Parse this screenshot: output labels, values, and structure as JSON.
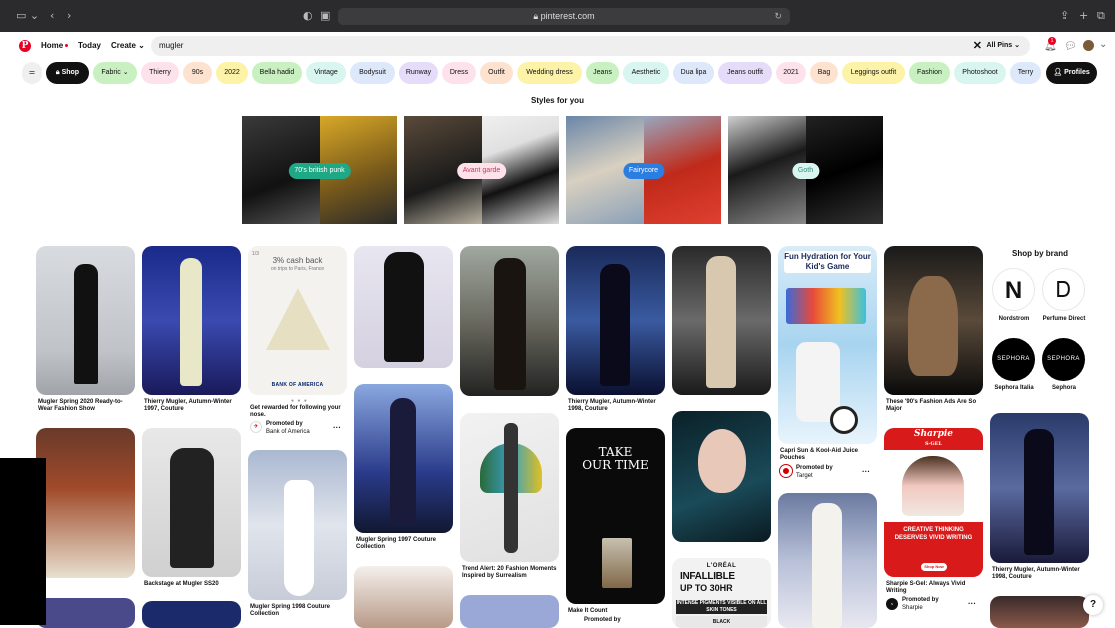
{
  "browser": {
    "url": "pinterest.com",
    "sidebar_icon": "sidebar-icon",
    "lock_icon": "lock-icon"
  },
  "header": {
    "logo": "P",
    "home_label": "Home",
    "today_label": "Today",
    "create_label": "Create",
    "search_value": "mugler",
    "search_scope": "All Pins",
    "notification_count": "1"
  },
  "chips": [
    {
      "label": "Shop",
      "bg": "#111111"
    },
    {
      "label": "Fabric",
      "bg": "#c8f0c0"
    },
    {
      "label": "Thierry",
      "bg": "#fde2ec"
    },
    {
      "label": "90s",
      "bg": "#fde3cf"
    },
    {
      "label": "2022",
      "bg": "#fdf3a8"
    },
    {
      "label": "Bella hadid",
      "bg": "#c8f0c0"
    },
    {
      "label": "Vintage",
      "bg": "#d8f5f0"
    },
    {
      "label": "Bodysuit",
      "bg": "#dde8fb"
    },
    {
      "label": "Runway",
      "bg": "#e4dcf9"
    },
    {
      "label": "Dress",
      "bg": "#fde2ec"
    },
    {
      "label": "Outfit",
      "bg": "#fde3cf"
    },
    {
      "label": "Wedding dress",
      "bg": "#fdf3a8"
    },
    {
      "label": "Jeans",
      "bg": "#c8f0c0"
    },
    {
      "label": "Aesthetic",
      "bg": "#d8f5f0"
    },
    {
      "label": "Dua lipa",
      "bg": "#dde8fb"
    },
    {
      "label": "Jeans outfit",
      "bg": "#e4dcf9"
    },
    {
      "label": "2021",
      "bg": "#fde2ec"
    },
    {
      "label": "Bag",
      "bg": "#fde3cf"
    },
    {
      "label": "Leggings outfit",
      "bg": "#fdf3a8"
    },
    {
      "label": "Fashion",
      "bg": "#c8f0c0"
    },
    {
      "label": "Photoshoot",
      "bg": "#d8f5f0"
    },
    {
      "label": "Terry",
      "bg": "#dde8fb"
    },
    {
      "label": "Profiles",
      "bg": "#111111"
    }
  ],
  "styles": {
    "title": "Styles for you",
    "items": [
      {
        "label": "70's british punk",
        "label_bg": "#1ea886",
        "label_color": "#ffffff"
      },
      {
        "label": "Avant garde",
        "label_bg": "#fde2ec",
        "label_color": "#c23c5a"
      },
      {
        "label": "Fairycore",
        "label_bg": "#2a7de1",
        "label_color": "#ffffff"
      },
      {
        "label": "Goth",
        "label_bg": "#d8f5f0",
        "label_color": "#3a8c7c"
      }
    ]
  },
  "pins": {
    "p1": "Mugler Spring 2020 Ready-to-Wear Fashion Show",
    "p2": "Thierry Mugler, Autumn-Winter 1997, Couture",
    "ad_cashback_title": "3% cash back",
    "ad_cashback_sub": "on trips to Paris, France",
    "ad_boa_brand": "BANK OF AMERICA",
    "ad_boa_caption": "Get rewarded for following your nose.",
    "ad_boa_promoted": "Promoted by",
    "ad_boa_by": "Bank of America",
    "ad_page_num": "1/3",
    "p_backstage": "Backstage at Mugler SS20",
    "p_spring1998": "Mugler Spring 1998 Couture Collection",
    "p_spring1997": "Mugler Spring 1997 Couture Collection",
    "p_trend": "Trend Alert: 20 Fashion Moments Inspired by Surrealism",
    "p_aw1998": "Thierry Mugler, Autumn-Winter 1998, Couture",
    "p_take_time_1": "TAKE",
    "p_take_time_2": "OUR TIME",
    "p_make_count": "Make It Count",
    "p_make_promoted": "Promoted by",
    "ad_capri_head": "Fun Hydration for Your Kid's Game",
    "ad_capri_caption": "Capri Sun & Kool-Aid Juice Pouches",
    "ad_capri_promoted": "Promoted by",
    "ad_capri_by": "Target",
    "p_90s": "These '90's Fashion Ads Are So Major",
    "ad_sharpie_brand": "Sharpie",
    "ad_sharpie_sub": "S·GEL",
    "ad_sharpie_tag": "CREATIVE THINKING DESERVES VIVID WRITING",
    "ad_sharpie_btn": "Shop Now",
    "ad_sharpie_caption": "Sharpie S-Gel: Always Vivid Writing",
    "ad_sharpie_promoted": "Promoted by",
    "ad_sharpie_by": "Sharpie",
    "p_aw1998b": "Thierry Mugler, Autumn-Winter 1998, Couture",
    "ad_loreal_brand": "L'ORÉAL",
    "ad_loreal_title": "INFALLIBLE",
    "ad_loreal_hr": "UP TO 30HR",
    "ad_loreal_band": "INTENSE PIGMENTS VISIBLE ON ALL SKIN TONES",
    "ad_loreal_black": "BLACK"
  },
  "brands": {
    "title": "Shop by brand",
    "items": [
      {
        "name": "Nordstrom",
        "mark": "N"
      },
      {
        "name": "Perfume Direct",
        "mark": "Ꭰ"
      },
      {
        "name": "Sephora Italia",
        "mark": "SEPHORA"
      },
      {
        "name": "Sephora",
        "mark": "SEPHORA"
      }
    ]
  },
  "help_label": "?"
}
